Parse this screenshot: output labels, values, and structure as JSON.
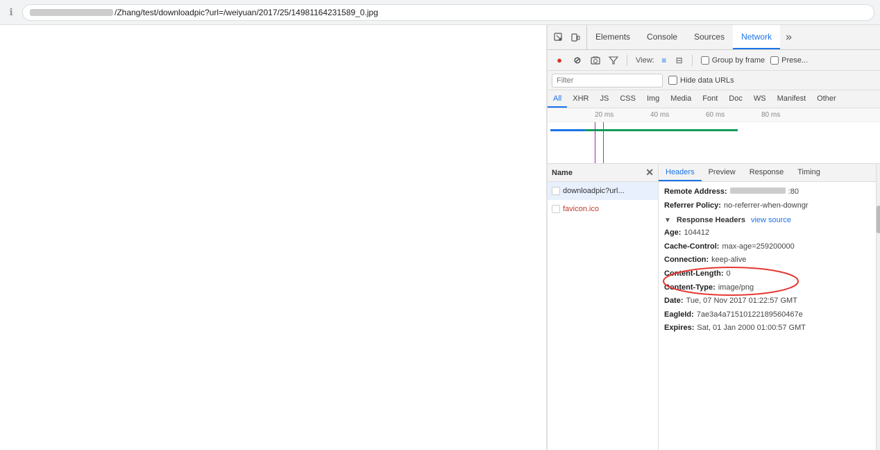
{
  "browser": {
    "url_prefix": "/Zhang/test/downloadpic?url=/weiyuan/2017/25/14981164231589_0.jpg",
    "url_blurred_placeholder": "███████████████"
  },
  "devtools": {
    "tabs": [
      "Elements",
      "Console",
      "Sources",
      "Network"
    ],
    "active_tab": "Network",
    "toolbar": {
      "record_label": "●",
      "stop_label": "⊘",
      "camera_label": "📷",
      "filter_label": "⋮",
      "view_label": "View:",
      "group_by_frame_label": "Group by frame",
      "preserve_label": "Prese..."
    },
    "filter": {
      "placeholder": "Filter",
      "hide_data_urls_label": "Hide data URLs"
    },
    "resource_tabs": [
      "All",
      "XHR",
      "JS",
      "CSS",
      "Img",
      "Media",
      "Font",
      "Doc",
      "WS",
      "Manifest",
      "Other"
    ],
    "active_resource_tab": "All",
    "timeline": {
      "marks": [
        "20 ms",
        "40 ms",
        "60 ms",
        "80 ms"
      ]
    },
    "requests": {
      "header": "Name",
      "items": [
        {
          "name": "downloadpic?url...",
          "selected": true,
          "type": "normal"
        },
        {
          "name": "favicon.ico",
          "selected": false,
          "type": "favicon"
        }
      ]
    },
    "header_tabs": [
      "Headers",
      "Preview",
      "Response",
      "Timing"
    ],
    "active_header_tab": "Headers",
    "headers": {
      "general": {
        "remote_address_label": "Remote Address:",
        "remote_address_value": ":80",
        "referrer_policy_label": "Referrer Policy:",
        "referrer_policy_value": "no-referrer-when-downgr"
      },
      "response_section_label": "Response Headers",
      "view_source_label": "view source",
      "response_headers": [
        {
          "key": "Age:",
          "value": "104412"
        },
        {
          "key": "Cache-Control:",
          "value": "max-age=259200000"
        },
        {
          "key": "Connection:",
          "value": "keep-alive"
        },
        {
          "key": "Content-Length:",
          "value": "0"
        },
        {
          "key": "Content-Type:",
          "value": "image/png"
        },
        {
          "key": "Date:",
          "value": "Tue, 07 Nov 2017 01:22:57 GMT"
        },
        {
          "key": "EagleId:",
          "value": "7ae3a4a71510122189560467e"
        },
        {
          "key": "Expires:",
          "value": "Sat, 01 Jan 2000 01:00:57 GMT"
        }
      ]
    }
  }
}
